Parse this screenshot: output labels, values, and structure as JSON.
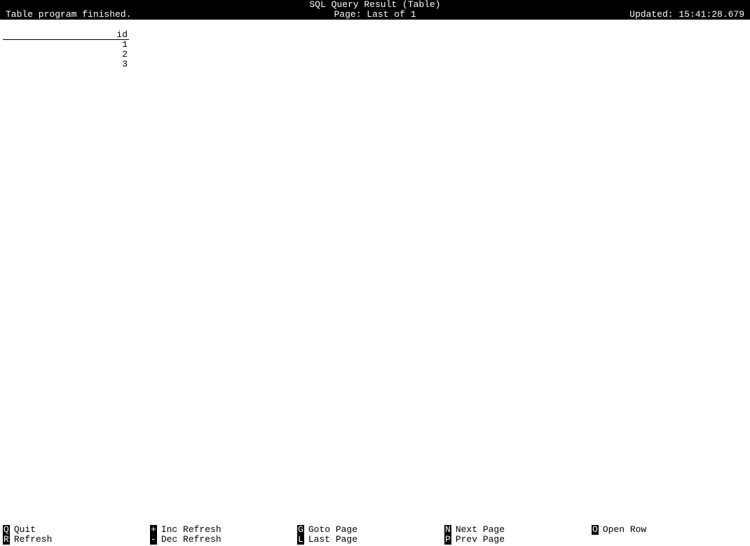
{
  "header": {
    "title": "SQL Query Result (Table)",
    "page": "Page: Last of 1",
    "status": "Table program finished.",
    "updated": "Updated: 15:41:28.679"
  },
  "table": {
    "columns": [
      "id"
    ],
    "rows": [
      "1",
      "2",
      "3"
    ]
  },
  "footer": {
    "cols": [
      [
        {
          "key": "Q",
          "label": "Quit"
        },
        {
          "key": "R",
          "label": "Refresh"
        }
      ],
      [
        {
          "key": "+",
          "label": "Inc Refresh"
        },
        {
          "key": "-",
          "label": "Dec Refresh"
        }
      ],
      [
        {
          "key": "G",
          "label": "Goto Page"
        },
        {
          "key": "L",
          "label": "Last Page"
        }
      ],
      [
        {
          "key": "N",
          "label": "Next Page"
        },
        {
          "key": "P",
          "label": "Prev Page"
        }
      ],
      [
        {
          "key": "O",
          "label": "Open Row"
        }
      ]
    ]
  }
}
